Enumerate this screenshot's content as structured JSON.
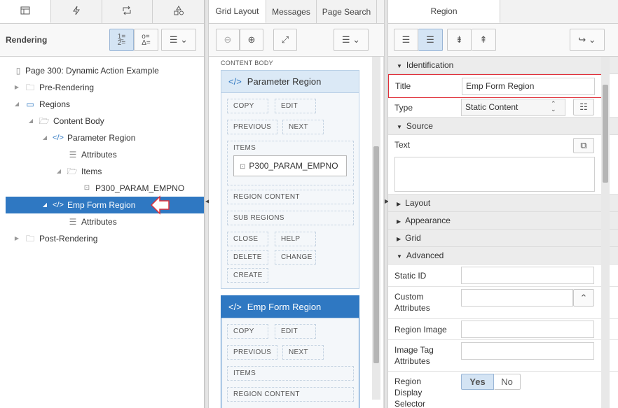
{
  "left": {
    "tab_icons": [
      "table-icon",
      "lightning-icon",
      "share-icon",
      "shapes-icon"
    ],
    "label": "Rendering",
    "tree": [
      {
        "label": "Page 300: Dynamic Action Example",
        "icon": "page-icon"
      },
      {
        "label": "Pre-Rendering",
        "icon": "folder-icon"
      },
      {
        "label": "Regions",
        "icon": "region-icon"
      },
      {
        "label": "Content Body",
        "icon": "folder-open-icon"
      },
      {
        "label": "Parameter Region",
        "icon": "code-icon"
      },
      {
        "label": "Attributes",
        "icon": "list-icon"
      },
      {
        "label": "Items",
        "icon": "folder-open-icon"
      },
      {
        "label": "P300_PARAM_EMPNO",
        "icon": "item-icon"
      },
      {
        "label": "Emp Form Region",
        "icon": "code-icon"
      },
      {
        "label": "Attributes",
        "icon": "list-icon"
      },
      {
        "label": "Post-Rendering",
        "icon": "folder-icon"
      }
    ]
  },
  "mid": {
    "tabs": [
      "Grid Layout",
      "Messages",
      "Page Search"
    ],
    "content_body": "CONTENT BODY",
    "region1": {
      "title": "Parameter Region",
      "copy": "COPY",
      "edit": "EDIT",
      "previous": "PREVIOUS",
      "next": "NEXT",
      "items": "ITEMS",
      "item": "P300_PARAM_EMPNO",
      "region_content": "REGION CONTENT",
      "sub_regions": "SUB REGIONS",
      "close": "CLOSE",
      "help": "HELP",
      "delete": "DELETE",
      "change": "CHANGE",
      "create": "CREATE"
    },
    "region2": {
      "title": "Emp Form Region",
      "copy": "COPY",
      "edit": "EDIT",
      "previous": "PREVIOUS",
      "next": "NEXT",
      "items": "ITEMS",
      "region_content": "REGION CONTENT"
    }
  },
  "right": {
    "tab": "Region",
    "identification": "Identification",
    "title_label": "Title",
    "title_value": "Emp Form Region",
    "type_label": "Type",
    "type_value": "Static Content",
    "source": "Source",
    "text_label": "Text",
    "layout": "Layout",
    "appearance": "Appearance",
    "grid": "Grid",
    "advanced": "Advanced",
    "static_id": "Static ID",
    "custom_attr_1": "Custom",
    "custom_attr_2": "Attributes",
    "region_image": "Region Image",
    "image_tag_1": "Image Tag",
    "image_tag_2": "Attributes",
    "rds_1": "Region",
    "rds_2": "Display",
    "rds_3": "Selector",
    "yes": "Yes",
    "no": "No"
  },
  "colors": {
    "accent": "#2f78c2",
    "highlight": "#e0303a"
  }
}
